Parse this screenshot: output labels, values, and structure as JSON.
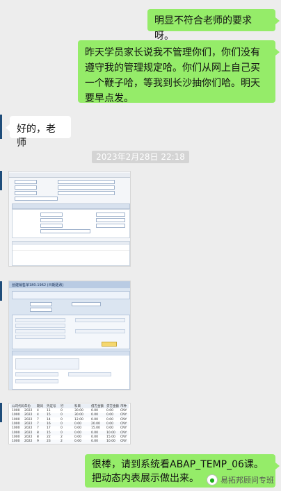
{
  "messages": {
    "m1": "明显不符合老师的要求呀。",
    "m2": "昨天学员家长说我不管理你们，你们没有遵守我的管理规定哈。你们从网上自己买一个鞭子哈，等我到长沙抽你们哈。明天要早点发。",
    "m3": "好的，老师",
    "m4": "很棒，请到系统看ABAP_TEMP_06课。把动态内表展示做出来。"
  },
  "timestamp": "2023年2月28日 22:18",
  "shot2": {
    "title": "创建销售单180-1962 (日期更改)"
  },
  "shot3": {
    "headers": [
      "公司代码",
      "年份",
      "期间",
      "凭证号",
      "行",
      "科目",
      "借方金额",
      "贷方金额",
      "币种"
    ],
    "rows": [
      [
        "1000",
        "2022",
        "4",
        "11",
        "0",
        "30.00",
        "0.00",
        "0.00",
        "CNY"
      ],
      [
        "1000",
        "2022",
        "4",
        "15",
        "0",
        "30.00",
        "0.00",
        "0.00",
        "CNY"
      ],
      [
        "1000",
        "2022",
        "7",
        "14",
        "0",
        "12.00",
        "0.00",
        "0.00",
        "CNY"
      ],
      [
        "1000",
        "2022",
        "7",
        "16",
        "0",
        "0.00",
        "20.00",
        "0.00",
        "CNY"
      ],
      [
        "1000",
        "2022",
        "7",
        "17",
        "0",
        "0.00",
        "15.00",
        "0.00",
        "CNY"
      ],
      [
        "1000",
        "2022",
        "8",
        "15",
        "0",
        "0.00",
        "0.00",
        "10.00",
        "CNY"
      ],
      [
        "1000",
        "2022",
        "8",
        "22",
        "2",
        "0.00",
        "0.00",
        "15.00",
        "CNY"
      ],
      [
        "1000",
        "2022",
        "9",
        "23",
        "2",
        "0.00",
        "0.00",
        "10.00",
        "CNY"
      ]
    ]
  },
  "watermark": "易拓邦顾问专班"
}
